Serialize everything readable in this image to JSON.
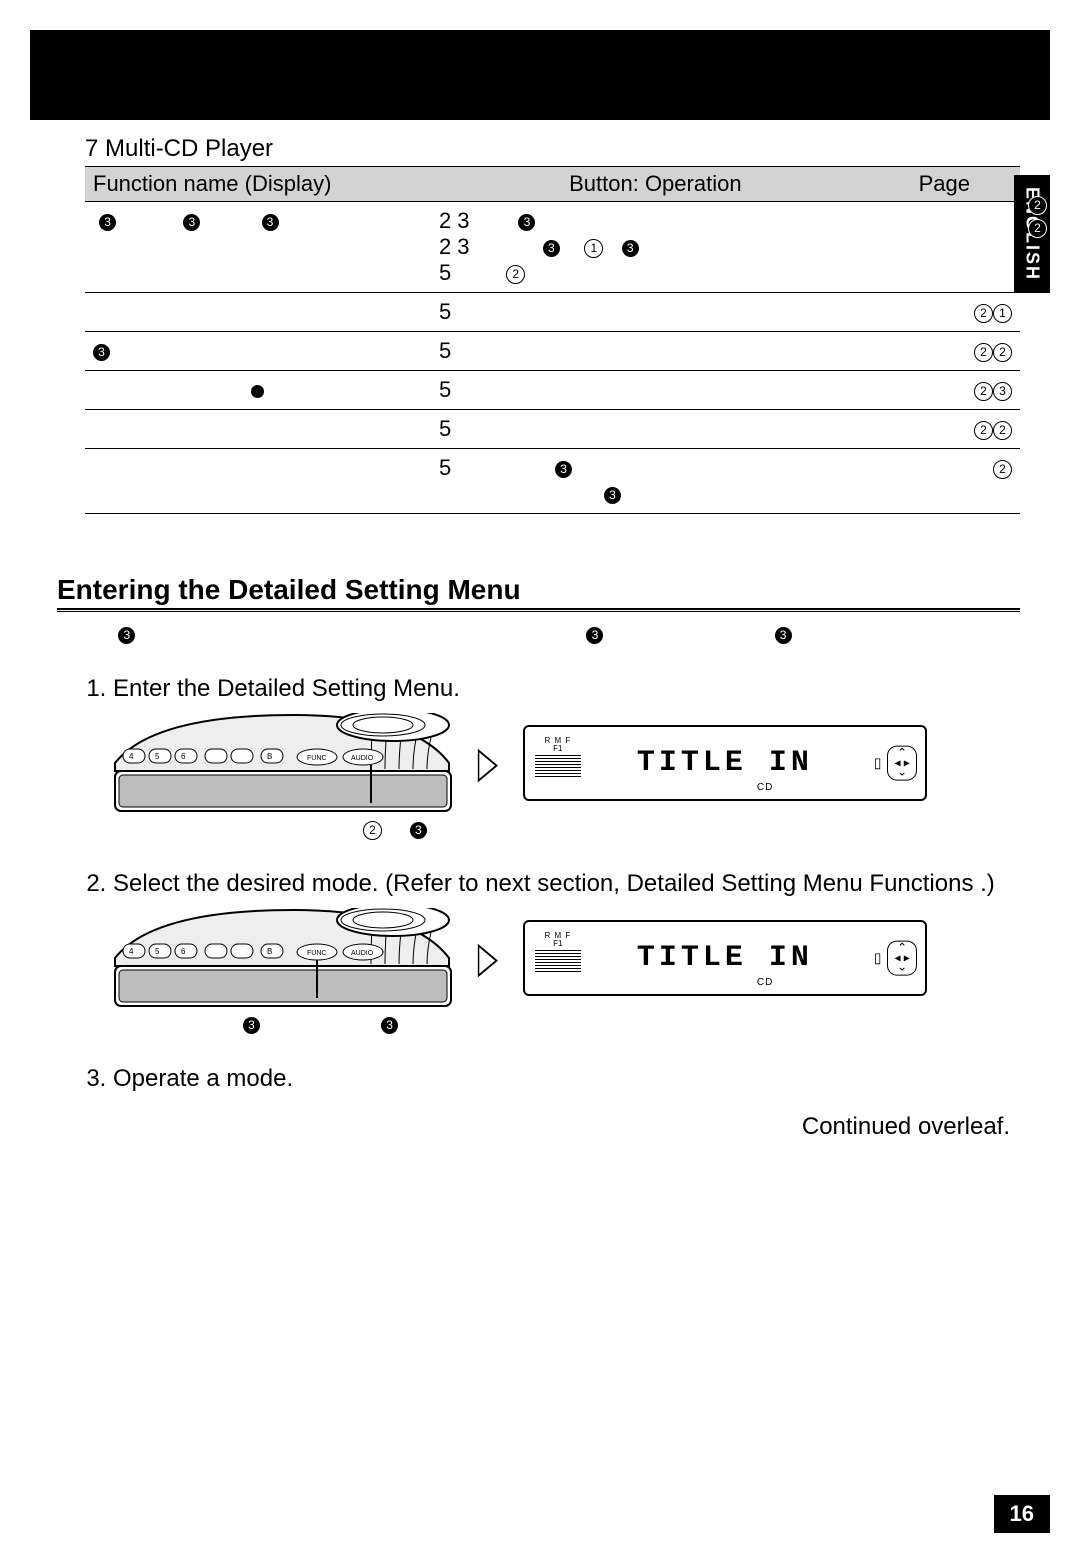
{
  "source_title": "7 Multi-CD Player",
  "table": {
    "headers": {
      "c1": "Function name (Display)",
      "c2": "Button: Operation",
      "c3": "Page"
    },
    "rows": [
      {
        "c1_a": "",
        "c1_b": "",
        "c2": "2   3",
        "c2b": "2   3",
        "c3": ""
      },
      {
        "c1_a": "",
        "c1_b": "",
        "c2": "5",
        "c3": "②①"
      },
      {
        "c1_a": "",
        "c1_b": "",
        "c2": "5",
        "c3": "②②"
      },
      {
        "c1_a": "",
        "c1_b": "",
        "c2": "5",
        "c3": "②③"
      },
      {
        "c1_a": "",
        "c1_b": "",
        "c2": "5",
        "c3": "②②"
      },
      {
        "c1_a": "",
        "c1_b": "",
        "c2": "5",
        "c3": "②"
      }
    ]
  },
  "section_title": "Entering the Detailed Setting Menu",
  "steps": {
    "s1": "Enter the Detailed Setting Menu.",
    "s2": "Select the desired mode. (Refer to next section,  Detailed Setting Menu Functions .)",
    "s3": "Operate a mode."
  },
  "lcd": {
    "top_sm": "R M    F",
    "main": "TITLE IN",
    "sub": "CD"
  },
  "continued": "Continued overleaf.",
  "lang_tab": "ENGLISH",
  "page_number": "16"
}
